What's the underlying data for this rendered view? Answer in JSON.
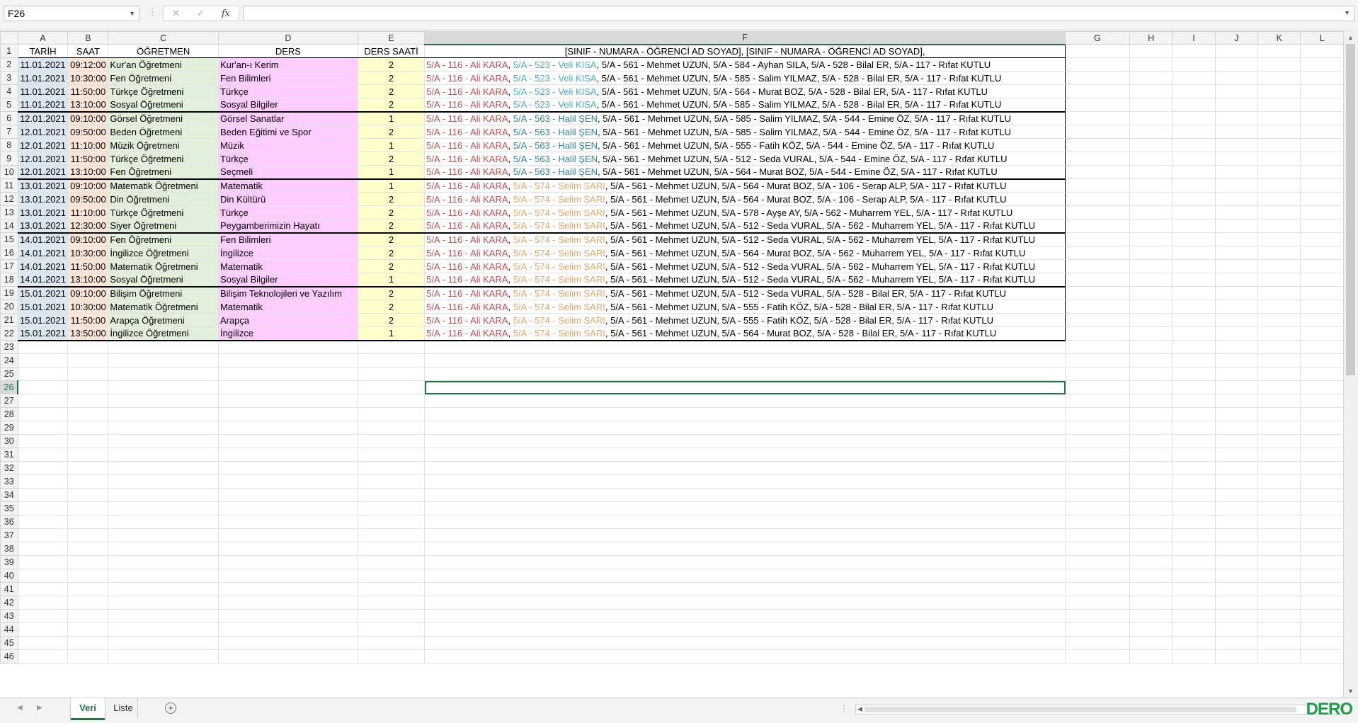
{
  "formula_bar": {
    "name_box": "F26",
    "formula": ""
  },
  "columns": [
    "A",
    "B",
    "C",
    "D",
    "E",
    "F",
    "G",
    "H",
    "I",
    "J",
    "K",
    "L"
  ],
  "header_row": [
    "TARİH",
    "SAAT",
    "ÖĞRETMEN",
    "DERS",
    "DERS SAATİ",
    "[SINIF - NUMARA - ÖĞRENCİ AD SOYAD], [SINIF - NUMARA - ÖĞRENCİ AD SOYAD],"
  ],
  "rows": [
    {
      "a": "11.01.2021",
      "b": "09:12:00",
      "c": "Kur'an Öğretmeni",
      "d": "Kur'an-ı Kerim",
      "e": "2",
      "s1": "5/A - 116 - Ali KARA",
      "s2": "5/A - 523 - Veli KISA",
      "s2c": "c",
      "rest": ", 5/A - 561 - Mehmet UZUN, 5/A - 584 - Ayhan SILA, 5/A - 528 - Bilal ER, 5/A - 117 - Rıfat KUTLU"
    },
    {
      "a": "11.01.2021",
      "b": "10:30:00",
      "c": "Fen Öğretmeni",
      "d": "Fen Bilimleri",
      "e": "2",
      "s1": "5/A - 116 - Ali KARA",
      "s2": "5/A - 523 - Veli KISA",
      "s2c": "c",
      "rest": ", 5/A - 561 - Mehmet UZUN, 5/A - 585 - Salim YILMAZ, 5/A - 528 - Bilal ER, 5/A - 117 - Rıfat KUTLU"
    },
    {
      "a": "11.01.2021",
      "b": "11:50:00",
      "c": "Türkçe Öğretmeni",
      "d": "Türkçe",
      "e": "2",
      "s1": "5/A - 116 - Ali KARA",
      "s2": "5/A - 523 - Veli KISA",
      "s2c": "c",
      "rest": ", 5/A - 561 - Mehmet UZUN, 5/A - 564 - Murat BOZ, 5/A - 528 - Bilal ER, 5/A - 117 - Rıfat KUTLU"
    },
    {
      "a": "11.01.2021",
      "b": "13:10:00",
      "c": "Sosyal Öğretmeni",
      "d": "Sosyal Bilgiler",
      "e": "2",
      "s1": "5/A - 116 - Ali KARA",
      "s2": "5/A - 523 - Veli KISA",
      "s2c": "c",
      "rest": ", 5/A - 561 - Mehmet UZUN, 5/A - 585 - Salim YILMAZ, 5/A - 528 - Bilal ER, 5/A - 117 - Rıfat KUTLU"
    },
    {
      "a": "12.01.2021",
      "b": "09:10:00",
      "c": "Görsel Öğretmeni",
      "d": "Görsel Sanatlar",
      "e": "1",
      "s1": "5/A - 116 - Ali KARA",
      "s2": "5/A - 563 - Halil ŞEN",
      "s2c": "g",
      "rest": ", 5/A - 561 - Mehmet UZUN, 5/A - 585 - Salim YILMAZ, 5/A - 544 - Emine ÖZ, 5/A - 117 - Rıfat KUTLU"
    },
    {
      "a": "12.01.2021",
      "b": "09:50:00",
      "c": "Beden Öğretmeni",
      "d": "Beden Eğitimi ve Spor",
      "e": "2",
      "s1": "5/A - 116 - Ali KARA",
      "s2": "5/A - 563 - Halil ŞEN",
      "s2c": "g",
      "rest": ", 5/A - 561 - Mehmet UZUN, 5/A - 585 - Salim YILMAZ, 5/A - 544 - Emine ÖZ, 5/A - 117 - Rıfat KUTLU"
    },
    {
      "a": "12.01.2021",
      "b": "11:10:00",
      "c": "Müzik Öğretmeni",
      "d": "Müzik",
      "e": "1",
      "s1": "5/A - 116 - Ali KARA",
      "s2": "5/A - 563 - Halil ŞEN",
      "s2c": "g",
      "rest": ", 5/A - 561 - Mehmet UZUN, 5/A - 555 - Fatih KÖZ, 5/A - 544 - Emine ÖZ, 5/A - 117 - Rıfat KUTLU"
    },
    {
      "a": "12.01.2021",
      "b": "11:50:00",
      "c": "Türkçe Öğretmeni",
      "d": "Türkçe",
      "e": "2",
      "s1": "5/A - 116 - Ali KARA",
      "s2": "5/A - 563 - Halil ŞEN",
      "s2c": "g",
      "rest": ", 5/A - 561 - Mehmet UZUN, 5/A - 512 - Seda VURAL, 5/A - 544 - Emine ÖZ, 5/A - 117 - Rıfat KUTLU"
    },
    {
      "a": "12.01.2021",
      "b": "13:10:00",
      "c": "Fen Öğretmeni",
      "d": "Seçmeli",
      "e": "1",
      "s1": "5/A - 116 - Ali KARA",
      "s2": "5/A - 563 - Halil ŞEN",
      "s2c": "g",
      "rest": ", 5/A - 561 - Mehmet UZUN, 5/A - 564 - Murat BOZ, 5/A - 544 - Emine ÖZ, 5/A - 117 - Rıfat KUTLU"
    },
    {
      "a": "13.01.2021",
      "b": "09:10:00",
      "c": "Matematik Öğretmeni",
      "d": "Matematik",
      "e": "1",
      "s1": "5/A - 116 - Ali KARA",
      "s2": "5/A - 574 - Selim SARI",
      "s2c": "o",
      "rest": ", 5/A - 561 - Mehmet UZUN, 5/A - 564 - Murat BOZ, 5/A - 106 - Serap ALP, 5/A - 117 - Rıfat KUTLU"
    },
    {
      "a": "13.01.2021",
      "b": "09:50:00",
      "c": "Din Öğretmeni",
      "d": "Din Kültürü",
      "e": "2",
      "s1": "5/A - 116 - Ali KARA",
      "s2": "5/A - 574 - Selim SARI",
      "s2c": "o",
      "rest": ", 5/A - 561 - Mehmet UZUN, 5/A - 564 - Murat BOZ, 5/A - 106 - Serap ALP, 5/A - 117 - Rıfat KUTLU"
    },
    {
      "a": "13.01.2021",
      "b": "11:10:00",
      "c": "Türkçe Öğretmeni",
      "d": "Türkçe",
      "e": "2",
      "s1": "5/A - 116 - Ali KARA",
      "s2": "5/A - 574 - Selim SARI",
      "s2c": "o",
      "rest": ", 5/A - 561 - Mehmet UZUN, 5/A - 578 - Ayşe AY, 5/A - 562 - Muharrem YEL, 5/A - 117 - Rıfat KUTLU"
    },
    {
      "a": "13.01.2021",
      "b": "12:30:00",
      "c": "Siyer Öğretmeni",
      "d": "Peygamberimizin Hayatı",
      "e": "2",
      "s1": "5/A - 116 - Ali KARA",
      "s2": "5/A - 574 - Selim SARI",
      "s2c": "o",
      "rest": ", 5/A - 561 - Mehmet UZUN, 5/A - 512 - Seda VURAL, 5/A - 562 - Muharrem YEL, 5/A - 117 - Rıfat KUTLU"
    },
    {
      "a": "14.01.2021",
      "b": "09:10:00",
      "c": "Fen Öğretmeni",
      "d": "Fen Bilimleri",
      "e": "2",
      "s1": "5/A - 116 - Ali KARA",
      "s2": "5/A - 574 - Selim SARI",
      "s2c": "o",
      "rest": ", 5/A - 561 - Mehmet UZUN, 5/A - 512 - Seda VURAL, 5/A - 562 - Muharrem YEL, 5/A - 117 - Rıfat KUTLU"
    },
    {
      "a": "14.01.2021",
      "b": "10:30:00",
      "c": "İngilizce Öğretmeni",
      "d": "İngilizce",
      "e": "2",
      "s1": "5/A - 116 - Ali KARA",
      "s2": "5/A - 574 - Selim SARI",
      "s2c": "o",
      "rest": ", 5/A - 561 - Mehmet UZUN, 5/A - 564 - Murat BOZ, 5/A - 562 - Muharrem YEL, 5/A - 117 - Rıfat KUTLU"
    },
    {
      "a": "14.01.2021",
      "b": "11:50:00",
      "c": "Matematik Öğretmeni",
      "d": "Matematik",
      "e": "2",
      "s1": "5/A - 116 - Ali KARA",
      "s2": "5/A - 574 - Selim SARI",
      "s2c": "o",
      "rest": ", 5/A - 561 - Mehmet UZUN, 5/A - 512 - Seda VURAL, 5/A - 562 - Muharrem YEL, 5/A - 117 - Rıfat KUTLU"
    },
    {
      "a": "14.01.2021",
      "b": "13:10:00",
      "c": "Sosyal Öğretmeni",
      "d": "Sosyal Bilgiler",
      "e": "1",
      "s1": "5/A - 116 - Ali KARA",
      "s2": "5/A - 574 - Selim SARI",
      "s2c": "o",
      "rest": ", 5/A - 561 - Mehmet UZUN, 5/A - 512 - Seda VURAL, 5/A - 562 - Muharrem YEL, 5/A - 117 - Rıfat KUTLU"
    },
    {
      "a": "15.01.2021",
      "b": "09:10:00",
      "c": "Bilişim Öğretmeni",
      "d": "Bilişim Teknolojileri ve Yazılım",
      "e": "2",
      "s1": "5/A - 116 - Ali KARA",
      "s2": "5/A - 574 - Selim SARI",
      "s2c": "o",
      "rest": ", 5/A - 561 - Mehmet UZUN, 5/A - 512 - Seda VURAL, 5/A - 528 - Bilal ER, 5/A - 117 - Rıfat KUTLU"
    },
    {
      "a": "15.01.2021",
      "b": "10:30:00",
      "c": "Matematik Öğretmeni",
      "d": "Matematik",
      "e": "2",
      "s1": "5/A - 116 - Ali KARA",
      "s2": "5/A - 574 - Selim SARI",
      "s2c": "o",
      "rest": ", 5/A - 561 - Mehmet UZUN, 5/A - 555 - Fatih KÖZ, 5/A - 528 - Bilal ER, 5/A - 117 - Rıfat KUTLU"
    },
    {
      "a": "15.01.2021",
      "b": "11:50:00",
      "c": "Arapça Öğretmeni",
      "d": "Arapça",
      "e": "2",
      "s1": "5/A - 116 - Ali KARA",
      "s2": "5/A - 574 - Selim SARI",
      "s2c": "o",
      "rest": ", 5/A - 561 - Mehmet UZUN, 5/A - 555 - Fatih KÖZ, 5/A - 528 - Bilal ER, 5/A - 117 - Rıfat KUTLU"
    },
    {
      "a": "15.01.2021",
      "b": "13:50:00",
      "c": "İngilizce Öğretmeni",
      "d": "İngilizce",
      "e": "1",
      "s1": "5/A - 116 - Ali KARA",
      "s2": "5/A - 574 - Selim SARI",
      "s2c": "o",
      "rest": ", 5/A - 561 - Mehmet UZUN, 5/A - 564 - Murat BOZ, 5/A - 528 - Bilal ER, 5/A - 117 - Rıfat KUTLU"
    }
  ],
  "group_start_rows": [
    6,
    11,
    15,
    19
  ],
  "total_rows": 46,
  "active_cell": {
    "row": 26,
    "col": "F"
  },
  "sheet_tabs": [
    "Veri",
    "Liste"
  ],
  "active_tab": "Veri",
  "watermark": "DERO",
  "colors": {
    "accent": "#217346",
    "s1": "#c0504d",
    "s2_cyan": "#4bacc6",
    "s2_teal": "#31859c",
    "s2_orange": "#e5a66a"
  }
}
